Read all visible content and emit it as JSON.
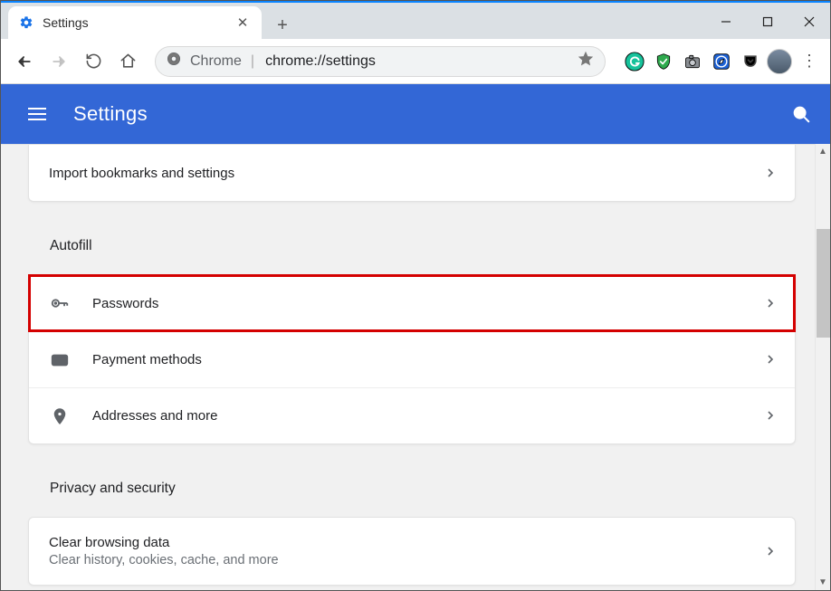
{
  "window": {
    "tab_title": "Settings",
    "new_tab_tooltip": "New tab"
  },
  "toolbar": {
    "omnibox_site": "Chrome",
    "omnibox_url": "chrome://settings"
  },
  "header": {
    "title": "Settings"
  },
  "sections": {
    "import": {
      "label": "Import bookmarks and settings"
    },
    "autofill": {
      "title": "Autofill",
      "items": [
        {
          "label": "Passwords"
        },
        {
          "label": "Payment methods"
        },
        {
          "label": "Addresses and more"
        }
      ]
    },
    "privacy": {
      "title": "Privacy and security",
      "clear": {
        "label": "Clear browsing data",
        "sub": "Clear history, cookies, cache, and more"
      }
    }
  }
}
